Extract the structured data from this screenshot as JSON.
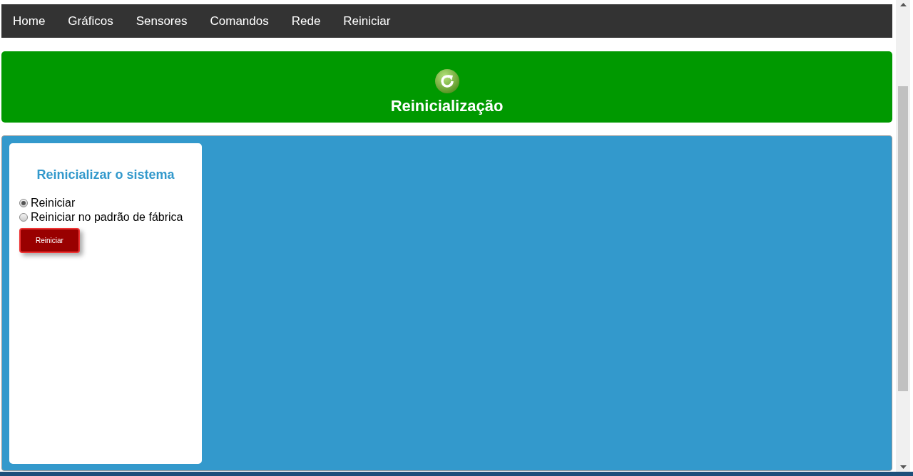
{
  "navbar": {
    "items": [
      {
        "label": "Home"
      },
      {
        "label": "Gráficos"
      },
      {
        "label": "Sensores"
      },
      {
        "label": "Comandos"
      },
      {
        "label": "Rede"
      },
      {
        "label": "Reiniciar"
      }
    ]
  },
  "header": {
    "title": "Reinicialização"
  },
  "panel": {
    "title": "Reinicializar o sistema",
    "options": [
      {
        "label": "Reiniciar",
        "selected": true
      },
      {
        "label": "Reiniciar no padrão de fábrica",
        "selected": false
      }
    ],
    "button": "Reiniciar"
  }
}
